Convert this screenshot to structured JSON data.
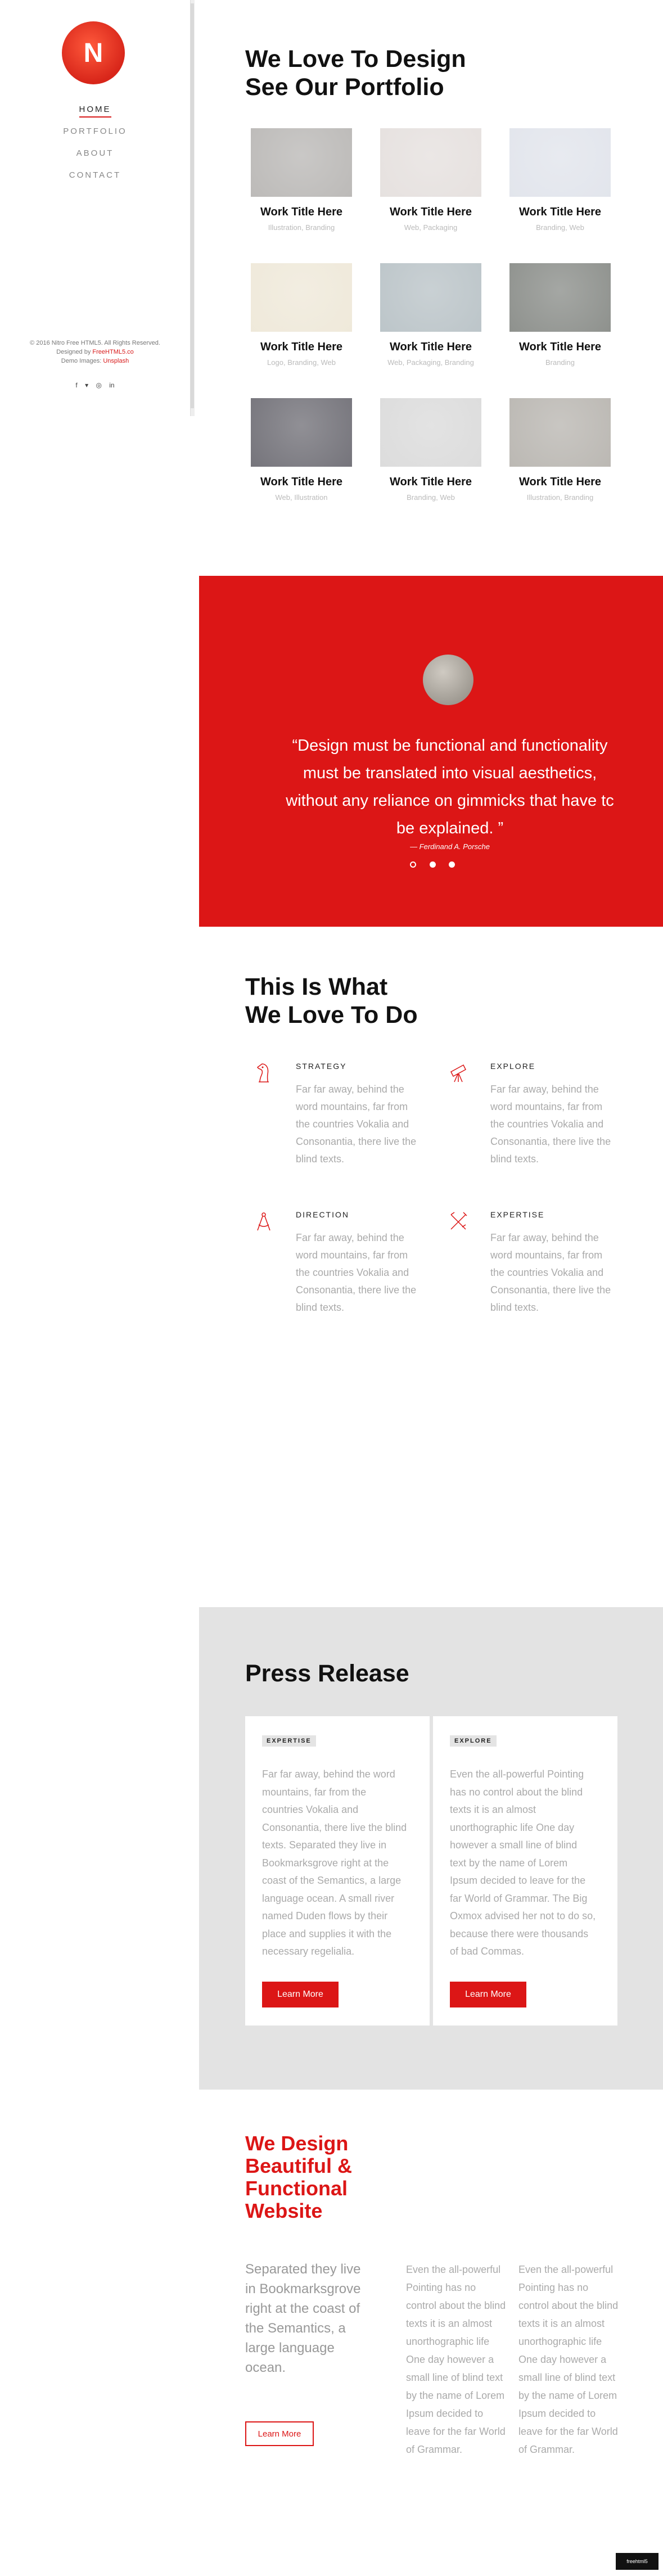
{
  "sidebar": {
    "logo_letter": "N",
    "nav": [
      {
        "label": "HOME"
      },
      {
        "label": "PORTFOLIO"
      },
      {
        "label": "ABOUT"
      },
      {
        "label": "CONTACT"
      }
    ],
    "footer": {
      "copyright": "© 2016 Nitro Free HTML5. All Rights Reserved.",
      "designed_prefix": "Designed by",
      "designed_link": "FreeHTML5.co",
      "demo_prefix": "Demo Images:",
      "demo_link": "Unsplash"
    },
    "socials": [
      {
        "icon": "facebook-icon",
        "glyph": "f"
      },
      {
        "icon": "twitter-icon",
        "glyph": "▾"
      },
      {
        "icon": "instagram-icon",
        "glyph": "◎"
      },
      {
        "icon": "linkedin-icon",
        "glyph": "in"
      }
    ]
  },
  "portfolio": {
    "title_line1": "We Love To Design",
    "title_line2": "See Our Portfolio",
    "items": [
      {
        "title": "Work Title Here",
        "tags": "Illustration, Branding",
        "color": "#bcbab8"
      },
      {
        "title": "Work Title Here",
        "tags": "Web, Packaging",
        "color": "#e6e1df"
      },
      {
        "title": "Work Title Here",
        "tags": "Branding, Web",
        "color": "#e2e5ec"
      },
      {
        "title": "Work Title Here",
        "tags": "Logo, Branding, Web",
        "color": "#efe9da"
      },
      {
        "title": "Work Title Here",
        "tags": "Web, Packaging, Branding",
        "color": "#bcc5c9"
      },
      {
        "title": "Work Title Here",
        "tags": "Branding",
        "color": "#8e918d"
      },
      {
        "title": "Work Title Here",
        "tags": "Web, Illustration",
        "color": "#75747b"
      },
      {
        "title": "Work Title Here",
        "tags": "Branding, Web",
        "color": "#dcdcdc"
      },
      {
        "title": "Work Title Here",
        "tags": "Illustration, Branding",
        "color": "#bbb8b3"
      }
    ]
  },
  "testimonial": {
    "quote_line1": "“Design must be functional and functionality",
    "quote_line2": "must be translated into visual aesthetics,",
    "quote_line3": "without any reliance on gimmicks that have tc",
    "quote_line4": "be explained. ”",
    "author": "— Ferdinand A. Porsche",
    "active_dot": 1,
    "accent": "#dc1616"
  },
  "services": {
    "title_line1": "This Is What",
    "title_line2": "We Love To Do",
    "items": [
      {
        "icon": "knight-icon",
        "heading": "STRATEGY",
        "text": "Far far away, behind the word mountains, far from the countries Vokalia and Consonantia, there live the blind texts."
      },
      {
        "icon": "telescope-icon",
        "heading": "EXPLORE",
        "text": "Far far away, behind the word mountains, far from the countries Vokalia and Consonantia, there live the blind texts."
      },
      {
        "icon": "compass-icon",
        "heading": "DIRECTION",
        "text": "Far far away, behind the word mountains, far from the countries Vokalia and Consonantia, there live the blind texts."
      },
      {
        "icon": "tools-icon",
        "heading": "EXPERTISE",
        "text": "Far far away, behind the word mountains, far from the countries Vokalia and Consonantia, there live the blind texts."
      }
    ]
  },
  "press": {
    "title": "Press Release",
    "cards": [
      {
        "badge": "EXPERTISE",
        "text": "Far far away, behind the word mountains, far from the countries Vokalia and Consonantia, there live the blind texts. Separated they live in Bookmarksgrove right at the coast of the Semantics, a large language ocean. A small river named Duden flows by their place and supplies it with the necessary regelialia.",
        "button": "Learn More"
      },
      {
        "badge": "EXPLORE",
        "text": "Even the all-powerful Pointing has no control about the blind texts it is an almost unorthographic life One day however a small line of blind text by the name of Lorem Ipsum decided to leave for the far World of Grammar. The Big Oxmox advised her not to do so, because there were thousands of bad Commas.",
        "button": "Learn More"
      }
    ]
  },
  "design": {
    "title": "We Design Beautiful & Functional Website",
    "lead": "Separated they live in Bookmarksgrove right at the coast of the Semantics, a large language ocean.",
    "button": "Learn More",
    "col1": "Even the all-powerful Pointing has no control about the blind texts it is an almost unorthographic life One day however a small line of blind text by the name of Lorem Ipsum decided to leave for the far World of Grammar.",
    "col2": "Even the all-powerful Pointing has no control about the blind texts it is an almost unorthographic life One day however a small line of blind text by the name of Lorem Ipsum decided to leave for the far World of Grammar."
  },
  "watermark": "freehtml5"
}
